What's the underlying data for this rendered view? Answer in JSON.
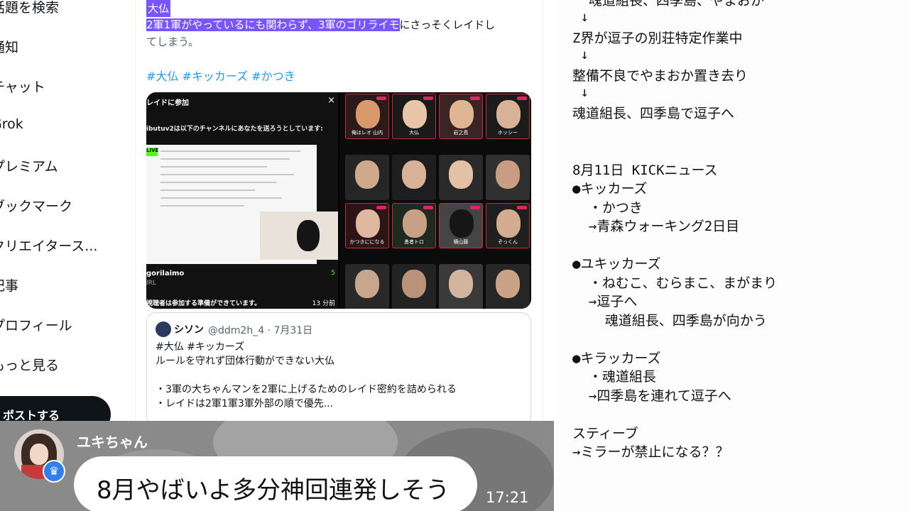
{
  "nav": {
    "items": [
      "話題を検索",
      "通知",
      "チャット",
      "Grok",
      "プレミアム",
      "ブックマーク",
      "クリエイタース...",
      "記事",
      "プロフィール",
      "もっと見る"
    ],
    "post_button": "ポストする"
  },
  "post": {
    "line1": "大仏",
    "line2_highlight": "2軍1軍がやっているにも関わらず、3軍のゴリライモ",
    "line2_rest": "にさっそくレイドし",
    "line3": "てしまう。",
    "hashtags": "#大仏 #キッカーズ #かつき"
  },
  "raid_panel": {
    "title": "レイドに参加",
    "close": "×",
    "subtitle": "ibutuv2は以下のチャンネルにあなたを送ろうとしています:",
    "live": "LIVE",
    "username": "gorilaimo",
    "category": "IRL",
    "viewers": "5",
    "footer": "視聴者は参加する準備ができています。",
    "countdown": "13 分前"
  },
  "grid_tiles": [
    {
      "name": "俺はレオ 山内",
      "face": "#d89a6a",
      "bg": "#2a1a1a"
    },
    {
      "name": "大仏",
      "face": "#e7c5a6",
      "bg": "#1a1a1a"
    },
    {
      "name": "岩之島",
      "face": "#e0b594",
      "bg": "#3a2424"
    },
    {
      "name": "ホッシー",
      "face": "#d9b197",
      "bg": "#1c1c1c"
    },
    {
      "name": "",
      "face": "#cfa98c",
      "bg": "#262626"
    },
    {
      "name": "",
      "face": "#d8b296",
      "bg": "#1e1e1e"
    },
    {
      "name": "",
      "face": "#e2c1a7",
      "bg": "#2a2a2a"
    },
    {
      "name": "",
      "face": "#c89d82",
      "bg": "#303030"
    },
    {
      "name": "かつきにになる",
      "face": "#e0b8a0",
      "bg": "#2b1515"
    },
    {
      "name": "勇者トロ",
      "face": "#c7a085",
      "bg": "#1d2a1d"
    },
    {
      "name": "横山藤",
      "face": "#161616",
      "bg": "#444444"
    },
    {
      "name": "ぞっくん",
      "face": "#d2ab90",
      "bg": "#1f1f1f"
    },
    {
      "name": "",
      "face": "#c8a58d",
      "bg": "#292929"
    },
    {
      "name": "",
      "face": "#b89279",
      "bg": "#232323"
    },
    {
      "name": "",
      "face": "#d3b49d",
      "bg": "#3a3a3a"
    },
    {
      "name": "",
      "face": "#caa286",
      "bg": "#262626"
    }
  ],
  "quote": {
    "name": "シソン",
    "handle": "@ddm2h_4 · 7月31日",
    "lines": [
      "#大仏 #キッカーズ",
      "ルールを守れず団体行動ができない大仏",
      "",
      "・3軍の大ちゃんマンを2軍に上げるためのレイド密約を詰められる",
      "・レイドは2軍1軍3軍外部の順で優先..."
    ]
  },
  "notes": {
    "lines": [
      "  魂道組長、四季島、やまおか",
      " ↓",
      "Z界が逗子の別荘特定作業中",
      " ↓",
      "整備不良でやまおか置き去り",
      " ↓",
      "魂道組長、四季島で逗子へ",
      "",
      "",
      "8月11日 KICKニュース",
      "●キッカーズ",
      "  ・かつき",
      "  →青森ウォーキング2日目",
      "",
      "●ユキッカーズ",
      "  ・ねむこ、むらまこ、まがまり",
      "  →逗子へ",
      "    魂道組長、四季島が向かう",
      "",
      "●キラッカーズ",
      "  ・魂道組長",
      "  →四季島を連れて逗子へ",
      "",
      "スティーブ",
      "→ミラーが禁止になる？？"
    ]
  },
  "comment": {
    "name": "ユキちゃん",
    "text": "8月やばいよ多分神回連発しそう",
    "time": "17:21"
  },
  "colors": {
    "highlight": "#7856ff",
    "link": "#1d9bf0",
    "kick_green": "#53fc18"
  }
}
